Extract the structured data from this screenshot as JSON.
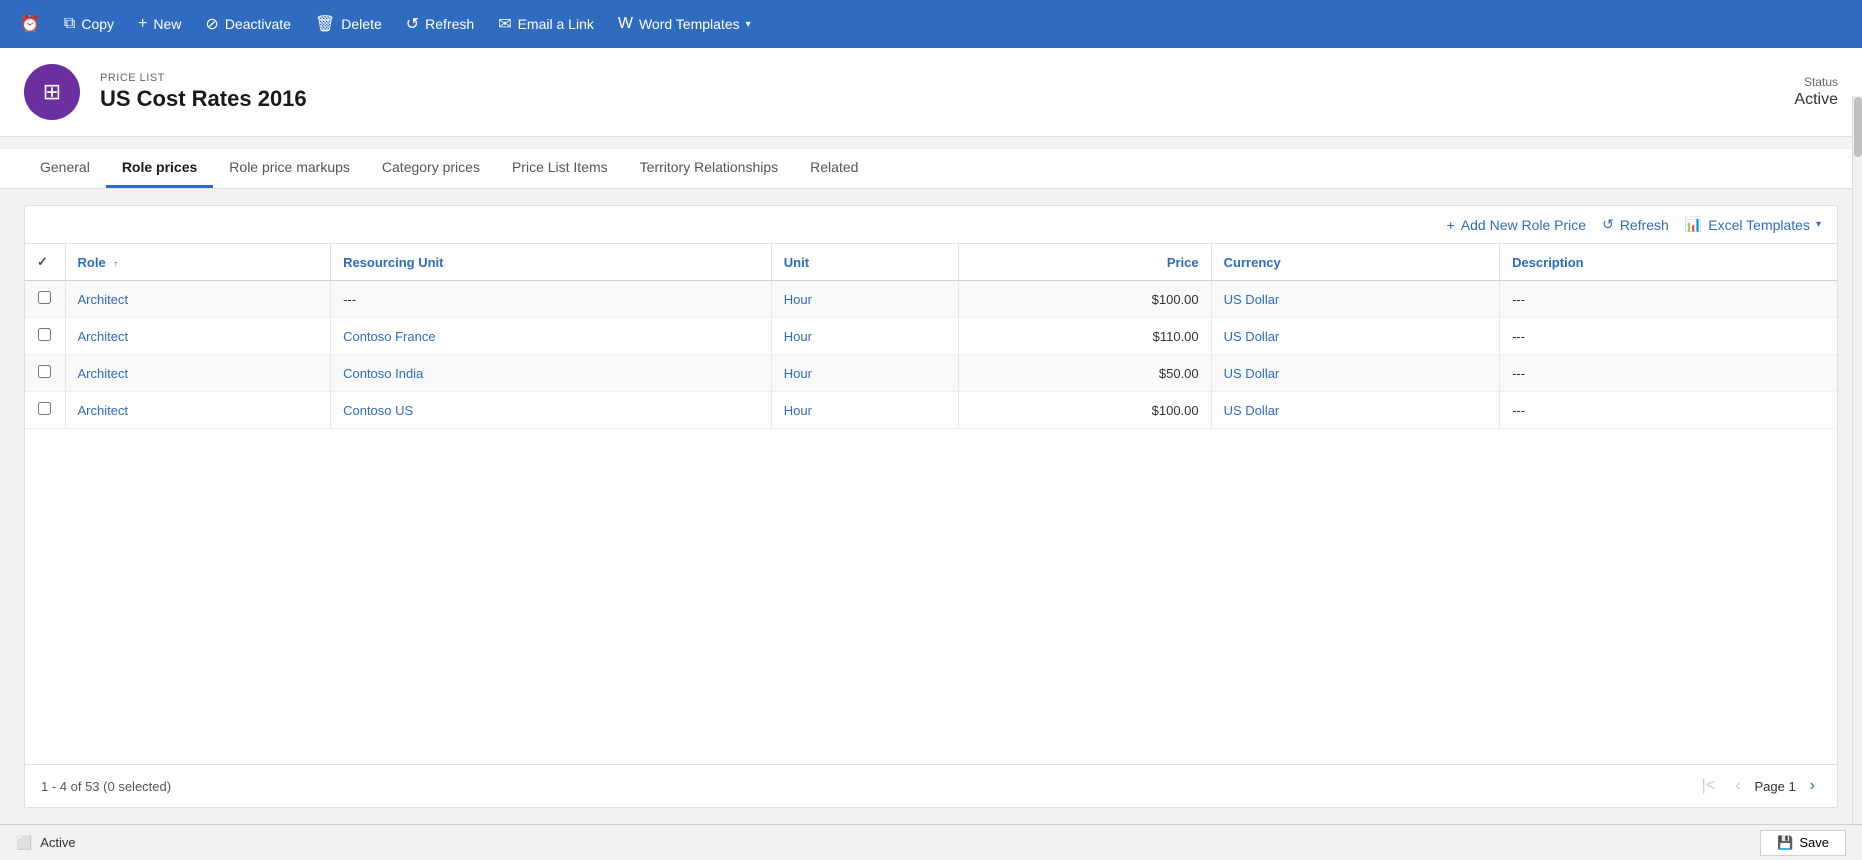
{
  "toolbar": {
    "buttons": [
      {
        "id": "copy",
        "label": "Copy",
        "icon": "⧉"
      },
      {
        "id": "new",
        "label": "New",
        "icon": "+"
      },
      {
        "id": "deactivate",
        "label": "Deactivate",
        "icon": "⊘"
      },
      {
        "id": "delete",
        "label": "Delete",
        "icon": "🗑"
      },
      {
        "id": "refresh",
        "label": "Refresh",
        "icon": "↺"
      },
      {
        "id": "email",
        "label": "Email a Link",
        "icon": "✉"
      },
      {
        "id": "word",
        "label": "Word Templates",
        "icon": "W",
        "hasDropdown": true
      }
    ]
  },
  "entity": {
    "type": "PRICE LIST",
    "name": "US Cost Rates 2016",
    "statusLabel": "Status",
    "statusValue": "Active",
    "avatarIcon": "≡"
  },
  "tabs": [
    {
      "id": "general",
      "label": "General",
      "active": false
    },
    {
      "id": "role-prices",
      "label": "Role prices",
      "active": true
    },
    {
      "id": "role-price-markups",
      "label": "Role price markups",
      "active": false
    },
    {
      "id": "category-prices",
      "label": "Category prices",
      "active": false
    },
    {
      "id": "price-list-items",
      "label": "Price List Items",
      "active": false
    },
    {
      "id": "territory-relationships",
      "label": "Territory Relationships",
      "active": false
    },
    {
      "id": "related",
      "label": "Related",
      "active": false
    }
  ],
  "grid": {
    "toolbar": {
      "add_label": "Add New Role Price",
      "refresh_label": "Refresh",
      "excel_label": "Excel Templates"
    },
    "columns": [
      {
        "id": "role",
        "label": "Role",
        "sortable": true
      },
      {
        "id": "resourcing-unit",
        "label": "Resourcing Unit",
        "sortable": false
      },
      {
        "id": "unit",
        "label": "Unit",
        "sortable": false
      },
      {
        "id": "price",
        "label": "Price",
        "sortable": false,
        "align": "right"
      },
      {
        "id": "currency",
        "label": "Currency",
        "sortable": false
      },
      {
        "id": "description",
        "label": "Description",
        "sortable": false
      }
    ],
    "rows": [
      {
        "role": "Architect",
        "resourcing_unit": "---",
        "unit": "Hour",
        "price": "$100.00",
        "currency": "US Dollar",
        "description": "---"
      },
      {
        "role": "Architect",
        "resourcing_unit": "Contoso France",
        "unit": "Hour",
        "price": "$110.00",
        "currency": "US Dollar",
        "description": "---"
      },
      {
        "role": "Architect",
        "resourcing_unit": "Contoso India",
        "unit": "Hour",
        "price": "$50.00",
        "currency": "US Dollar",
        "description": "---"
      },
      {
        "role": "Architect",
        "resourcing_unit": "Contoso US",
        "unit": "Hour",
        "price": "$100.00",
        "currency": "US Dollar",
        "description": "---"
      }
    ],
    "pagination": {
      "summary": "1 - 4 of 53 (0 selected)",
      "page_label": "Page 1"
    }
  },
  "statusbar": {
    "status": "Active",
    "save_label": "Save"
  }
}
